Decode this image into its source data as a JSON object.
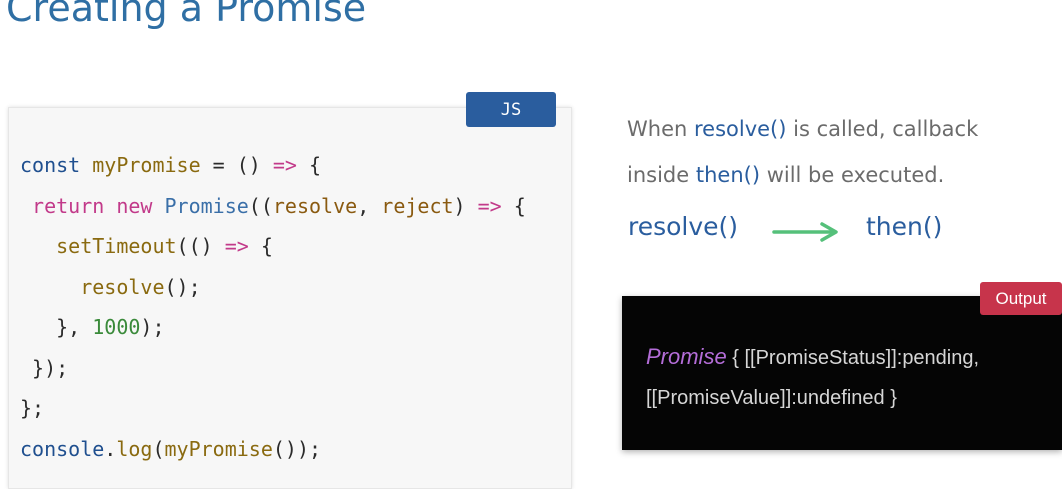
{
  "slide": {
    "title": "Creating a Promise"
  },
  "code_panel": {
    "language_badge": "JS",
    "lines": [
      [
        {
          "t": "const ",
          "c": "kw"
        },
        {
          "t": "myPromise",
          "c": "fn"
        },
        {
          "t": " = () ",
          "c": ""
        },
        {
          "t": "=>",
          "c": "op"
        },
        {
          "t": " {",
          "c": ""
        }
      ],
      [
        {
          "t": " return ",
          "c": "op"
        },
        {
          "t": "new ",
          "c": "op"
        },
        {
          "t": "Promise",
          "c": "cls"
        },
        {
          "t": "((",
          "c": ""
        },
        {
          "t": "resolve",
          "c": "pm"
        },
        {
          "t": ", ",
          "c": ""
        },
        {
          "t": "reject",
          "c": "pm"
        },
        {
          "t": ") ",
          "c": ""
        },
        {
          "t": "=>",
          "c": "op"
        },
        {
          "t": " {",
          "c": ""
        }
      ],
      [
        {
          "t": "   ",
          "c": ""
        },
        {
          "t": "setTimeout",
          "c": "fn"
        },
        {
          "t": "(() ",
          "c": ""
        },
        {
          "t": "=>",
          "c": "op"
        },
        {
          "t": " {",
          "c": ""
        }
      ],
      [
        {
          "t": "     ",
          "c": ""
        },
        {
          "t": "resolve",
          "c": "fn"
        },
        {
          "t": "();",
          "c": ""
        }
      ],
      [
        {
          "t": "   }, ",
          "c": ""
        },
        {
          "t": "1000",
          "c": "num"
        },
        {
          "t": ");",
          "c": ""
        }
      ],
      [
        {
          "t": " });",
          "c": ""
        }
      ],
      [
        {
          "t": "};",
          "c": ""
        }
      ],
      [
        {
          "t": "console",
          "c": "kw"
        },
        {
          "t": ".",
          "c": ""
        },
        {
          "t": "log",
          "c": "fn"
        },
        {
          "t": "(",
          "c": ""
        },
        {
          "t": "myPromise",
          "c": "fn"
        },
        {
          "t": "());",
          "c": ""
        }
      ]
    ]
  },
  "description": {
    "line1_prefix": "When ",
    "line1_highlight": "resolve()",
    "line1_suffix": " is called, callback",
    "line2_prefix": "inside ",
    "line2_highlight": "then()",
    "line2_suffix": " will be executed."
  },
  "flow": {
    "from": "resolve()",
    "to": "then()",
    "arrow_icon": "arrow-right-icon",
    "arrow_color": "#55c07a"
  },
  "output_panel": {
    "badge": "Output",
    "class_name": "Promise",
    "line1_rest": " { [[PromiseStatus]]:pending,",
    "line2": "[[PromiseValue]]:undefined }"
  },
  "colors": {
    "title": "#2f6fa4",
    "accent_blue": "#2a5d9e",
    "output_badge": "#c7344b",
    "output_bg": "#050505"
  }
}
